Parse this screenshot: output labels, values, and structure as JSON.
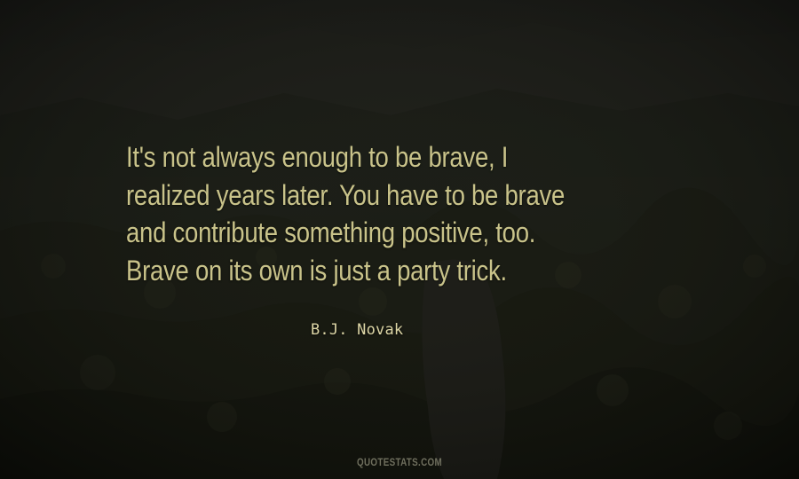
{
  "quote": {
    "lines": [
      "It's not always enough to be brave, I",
      "realized years later. You have to be brave",
      "and contribute something positive, too.",
      "Brave on its own is just a party trick."
    ]
  },
  "author": "B.J. Novak",
  "watermark": "QUOTESTATS.COM",
  "colors": {
    "quote_text": "#c9c38a",
    "author_text": "#ddd6a6",
    "background": "#151712"
  }
}
